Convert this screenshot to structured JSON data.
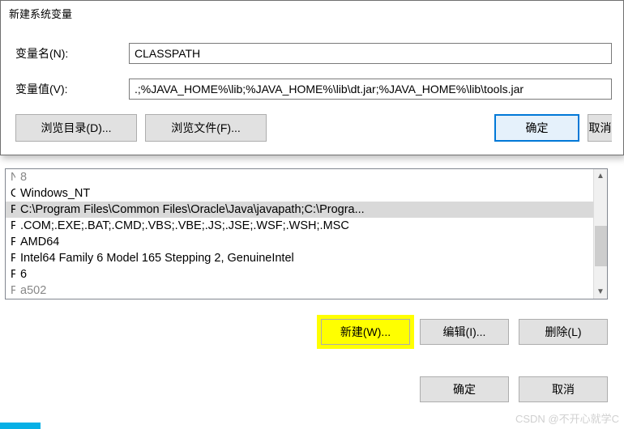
{
  "dialog": {
    "title": "新建系统变量",
    "nameLabel": "变量名(N):",
    "nameValue": "CLASSPATH",
    "valueLabel": "变量值(V):",
    "valueValue": ".;%JAVA_HOME%\\lib;%JAVA_HOME%\\lib\\dt.jar;%JAVA_HOME%\\lib\\tools.jar",
    "browseDir": "浏览目录(D)...",
    "browseFile": "浏览文件(F)...",
    "ok": "确定",
    "cancel": "取消"
  },
  "env": {
    "rows": [
      {
        "name": "NUMBER_OF_PROCESSORS",
        "value": "8",
        "cut": true
      },
      {
        "name": "OS",
        "value": "Windows_NT"
      },
      {
        "name": "Path",
        "value": "C:\\Program Files\\Common Files\\Oracle\\Java\\javapath;C:\\Progra...",
        "selected": true
      },
      {
        "name": "PATHEXT",
        "value": ".COM;.EXE;.BAT;.CMD;.VBS;.VBE;.JS;.JSE;.WSF;.WSH;.MSC"
      },
      {
        "name": "PROCESSOR_ARCHITECTURE",
        "value": "AMD64"
      },
      {
        "name": "PROCESSOR_IDENTIFIER",
        "value": "Intel64 Family 6 Model 165 Stepping 2, GenuineIntel"
      },
      {
        "name": "PROCESSOR_LEVEL",
        "value": "6"
      },
      {
        "name": "PROCESSOR_REVISION",
        "value": "a502",
        "cut": true
      }
    ]
  },
  "buttons": {
    "new": "新建(W)...",
    "edit": "编辑(I)...",
    "delete": "删除(L)",
    "ok": "确定",
    "cancel": "取消"
  },
  "watermark": "CSDN @不开心就学C"
}
